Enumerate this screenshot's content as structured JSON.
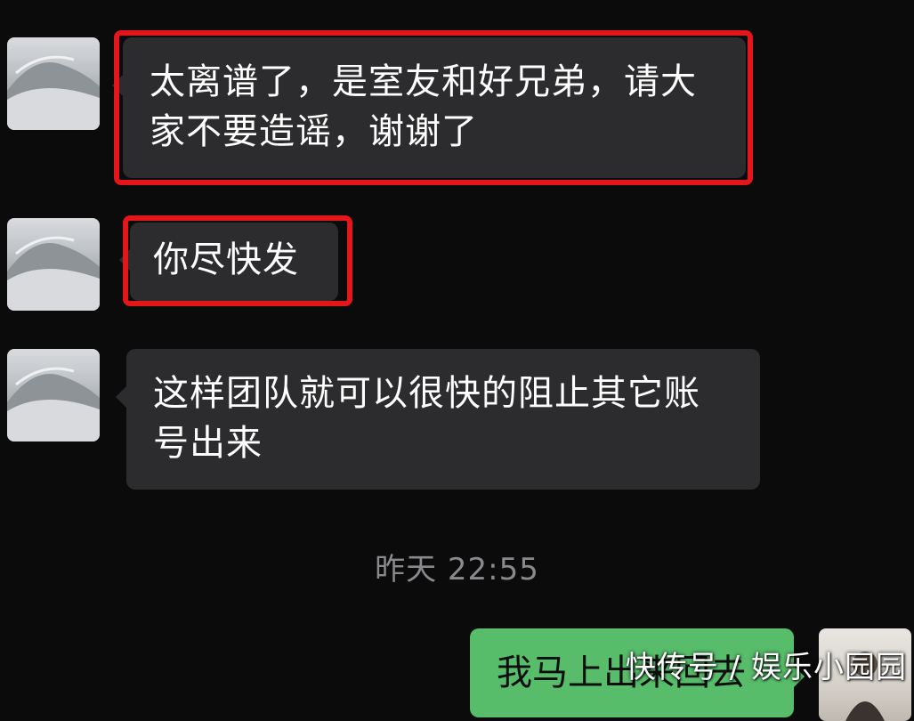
{
  "messages": [
    {
      "text_line1": "太离谱了，是室友和好兄弟，请大",
      "text_line2": "家不要造谣，谢谢了"
    },
    {
      "text": "你尽快发"
    },
    {
      "text_line1": "这样团队就可以很快的阻止其它账",
      "text_line2": "号出来"
    }
  ],
  "timestamp": "昨天 22:55",
  "my_message": {
    "text": "我马上出来回去"
  },
  "watermark": "快传号 / 娱乐小园园",
  "colors": {
    "highlight": "#e3161b",
    "bubble_other": "#2c2c2e",
    "bubble_me": "#57bd6a",
    "background": "#0b0b0c"
  }
}
